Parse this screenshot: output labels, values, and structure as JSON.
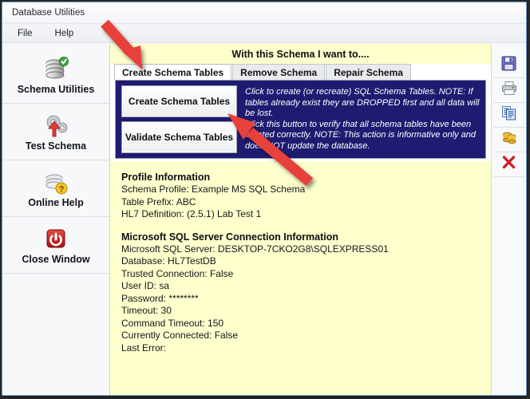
{
  "window": {
    "title": "Database Utilities",
    "border_color": "#6f9fd0"
  },
  "menubar": {
    "items": [
      {
        "label": "File",
        "name": "menu-file"
      },
      {
        "label": "Help",
        "name": "menu-help"
      }
    ]
  },
  "sidebar": {
    "items": [
      {
        "label": "Schema Utilities",
        "icon": "database-check-icon",
        "name": "sidebar-item-schema-utilities"
      },
      {
        "label": "Test Schema",
        "icon": "gears-arrow-icon",
        "name": "sidebar-item-test-schema"
      },
      {
        "label": "Online Help",
        "icon": "database-question-icon",
        "name": "sidebar-item-online-help"
      },
      {
        "label": "Close Window",
        "icon": "power-icon",
        "name": "sidebar-item-close-window"
      }
    ]
  },
  "main": {
    "banner": "With this Schema I want to....",
    "banner_bg": "#feffcc",
    "tabs": [
      {
        "label": "Create Schema Tables",
        "active": true
      },
      {
        "label": "Remove Schema",
        "active": false
      },
      {
        "label": "Repair Schema",
        "active": false
      }
    ],
    "action_panel": {
      "bg": "#1e1b71",
      "buttons": [
        {
          "label": "Create Schema Tables"
        },
        {
          "label": "Validate Schema Tables"
        }
      ],
      "descriptions": [
        "Click to create (or recreate) SQL Schema Tables. NOTE: If tables already exist they are DROPPED first and all data will be lost.",
        "Click this button to verify that all schema tables have been created correctly. NOTE: This action is informative only and does NOT update the database."
      ]
    },
    "info": {
      "section1_title": "Profile Information",
      "section1_lines": [
        "Schema Profile: Example MS SQL Schema",
        "Table Prefix: ABC",
        "HL7 Definition: (2.5.1) Lab Test 1"
      ],
      "section2_title": "Microsoft SQL Server Connection Information",
      "section2_lines": [
        "Microsoft SQL Server: DESKTOP-7CKO2G8\\SQLEXPRESS01",
        "Database: HL7TestDB",
        "Trusted Connection: False",
        "User ID: sa",
        "Password: ********",
        "Timeout: 30",
        "Command Timeout: 150",
        "Currently Connected: False",
        "Last Error:"
      ]
    }
  },
  "icon_rail": {
    "buttons": [
      {
        "icon": "save-floppy-icon",
        "name": "save-button"
      },
      {
        "icon": "printer-icon",
        "name": "print-button"
      },
      {
        "icon": "copy-icon",
        "name": "copy-button"
      },
      {
        "icon": "database-icon",
        "name": "database-button"
      },
      {
        "icon": "red-x-icon",
        "name": "clear-button"
      }
    ]
  },
  "annotations": {
    "arrow_color": "#e8403a",
    "arrows": [
      {
        "name": "arrow-to-create-schema-tables-tab"
      },
      {
        "name": "arrow-to-create-schema-tables-button"
      }
    ]
  }
}
